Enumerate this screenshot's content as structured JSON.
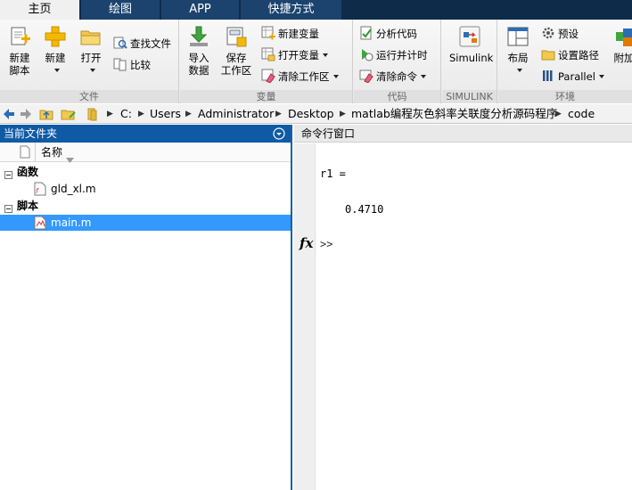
{
  "tabs": [
    {
      "label": "主页",
      "active": true
    },
    {
      "label": "绘图",
      "active": false
    },
    {
      "label": "APP",
      "active": false
    },
    {
      "label": "快捷方式",
      "active": false
    }
  ],
  "ribbon": {
    "file": {
      "group_label": "文件",
      "new_script": "新建\n脚本",
      "new": "新建",
      "open": "打开",
      "find_files": "查找文件",
      "compare": "比较"
    },
    "variable": {
      "group_label": "变量",
      "import_data": "导入\n数据",
      "save_workspace": "保存\n工作区",
      "new_variable": "新建变量",
      "open_variable": "打开变量",
      "clear_workspace": "清除工作区"
    },
    "code": {
      "group_label": "代码",
      "analyze_code": "分析代码",
      "run_and_time": "运行并计时",
      "clear_commands": "清除命令"
    },
    "simulink": {
      "group_label": "SIMULINK",
      "simulink": "Simulink"
    },
    "environment": {
      "group_label": "环境",
      "layout": "布局",
      "preferences": "预设",
      "set_path": "设置路径",
      "parallel": "Parallel",
      "addons": "附加"
    }
  },
  "address": {
    "path": [
      "C:",
      "Users",
      "Administrator",
      "Desktop",
      "matlab编程灰色斜率关联度分析源码程序",
      "code"
    ]
  },
  "current_folder": {
    "title": "当前文件夹",
    "column_name": "名称",
    "groups": [
      {
        "label": "函数",
        "files": [
          "gld_xl.m"
        ]
      },
      {
        "label": "脚本",
        "files": [
          "main.m"
        ]
      }
    ],
    "selected_file": "main.m"
  },
  "command_window": {
    "title": "命令行窗口",
    "output_var": "r1 =",
    "output_value": "0.4710",
    "prompt": ">>",
    "fx": "fx"
  }
}
